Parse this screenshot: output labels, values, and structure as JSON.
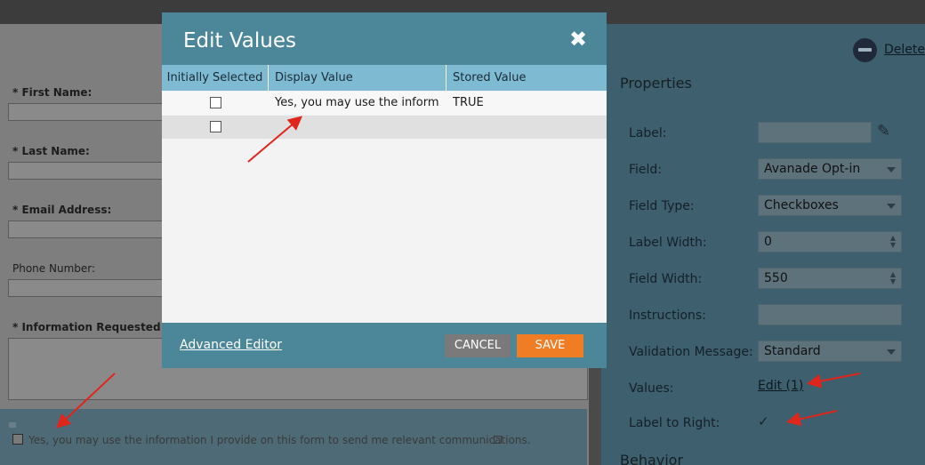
{
  "form": {
    "fields": [
      {
        "label": "First Name:",
        "required": true
      },
      {
        "label": "Last Name:",
        "required": true
      },
      {
        "label": "Email Address:",
        "required": true
      },
      {
        "label": "Phone Number:",
        "required": false
      },
      {
        "label": "Information Requested or Qu",
        "required": true
      }
    ],
    "required_marker": "*",
    "checkbox_text": "Yes, you may use the information I provide on this form to send me relevant communications."
  },
  "panel": {
    "delete_label": "Delete",
    "properties_title": "Properties",
    "behavior_title": "Behavior",
    "label_label": "Label:",
    "label_value": "",
    "field_label": "Field:",
    "field_value": "Avanade Opt-in",
    "field_type_label": "Field Type:",
    "field_type_value": "Checkboxes",
    "label_width_label": "Label Width:",
    "label_width_value": "0",
    "field_width_label": "Field Width:",
    "field_width_value": "550",
    "instructions_label": "Instructions:",
    "instructions_value": "",
    "validation_label": "Validation Message:",
    "validation_value": "Standard",
    "values_label": "Values:",
    "values_link": "Edit (1)",
    "label_right_label": "Label to Right:",
    "label_right_mark": "✓"
  },
  "modal": {
    "title": "Edit Values",
    "close_glyph": "✖",
    "columns": [
      "Initially Selected",
      "Display Value",
      "Stored Value"
    ],
    "rows": [
      {
        "selected": false,
        "display": "Yes, you may use the inform...",
        "stored": "TRUE"
      },
      {
        "selected": false,
        "display": "",
        "stored": ""
      }
    ],
    "advanced_editor": "Advanced Editor",
    "cancel_label": "CANCEL",
    "save_label": "SAVE"
  },
  "colors": {
    "modal_header": "#4b8799",
    "grid_header": "#7fbad3",
    "save_button": "#f07d23",
    "cancel_button": "#7a7a7a",
    "annotation_arrow": "#e0251b"
  }
}
